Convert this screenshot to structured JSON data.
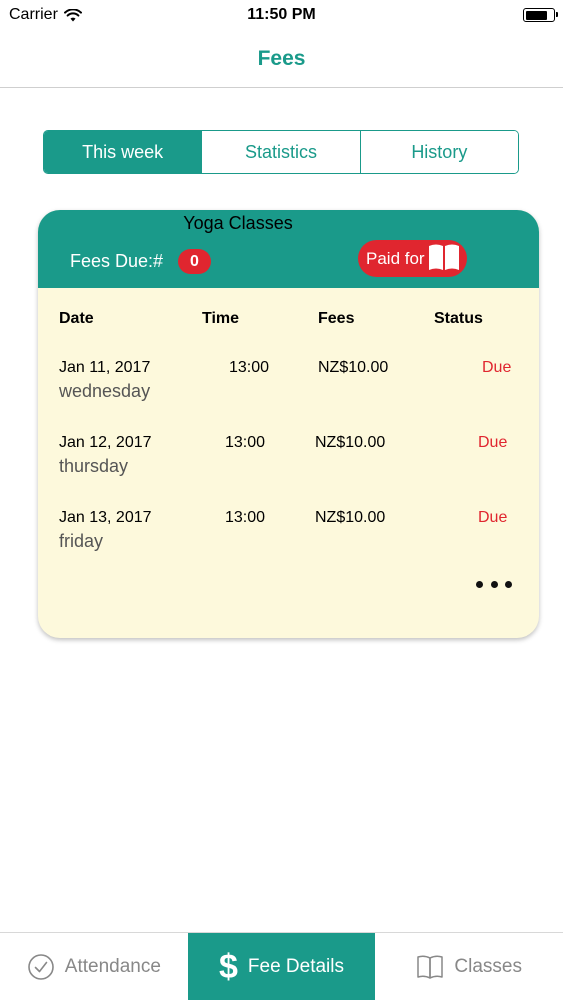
{
  "status_bar": {
    "carrier": "Carrier",
    "time": "11:50 PM",
    "battery_level": 0.8
  },
  "nav": {
    "title": "Fees"
  },
  "segments": [
    {
      "label": "This week",
      "active": true
    },
    {
      "label": "Statistics",
      "active": false
    },
    {
      "label": "History",
      "active": false
    }
  ],
  "card": {
    "title": "Yoga Classes",
    "fees_due_label": "Fees Due:#",
    "fees_due_count": "0",
    "paid_label": "Paid for",
    "paid_icon": "book-icon",
    "columns": [
      "Date",
      "Time",
      "Fees",
      "Status"
    ],
    "rows": [
      {
        "date": "Jan 11, 2017",
        "day": "wednesday",
        "time": "13:00",
        "fee": "NZ$10.00",
        "status": "Due"
      },
      {
        "date": "Jan 12, 2017",
        "day": "thursday",
        "time": "13:00",
        "fee": "NZ$10.00",
        "status": "Due"
      },
      {
        "date": "Jan 13, 2017",
        "day": "friday",
        "time": "13:00",
        "fee": "NZ$10.00",
        "status": "Due"
      }
    ]
  },
  "tabs": [
    {
      "label": "Attendance",
      "icon": "checkmark-circle-icon",
      "active": false
    },
    {
      "label": "Fee Details",
      "icon": "dollar-icon",
      "active": true
    },
    {
      "label": "Classes",
      "icon": "book-outline-icon",
      "active": false
    }
  ],
  "colors": {
    "accent": "#1a9a8a",
    "due": "#e0262f",
    "card_background": "#fdf9dc"
  }
}
